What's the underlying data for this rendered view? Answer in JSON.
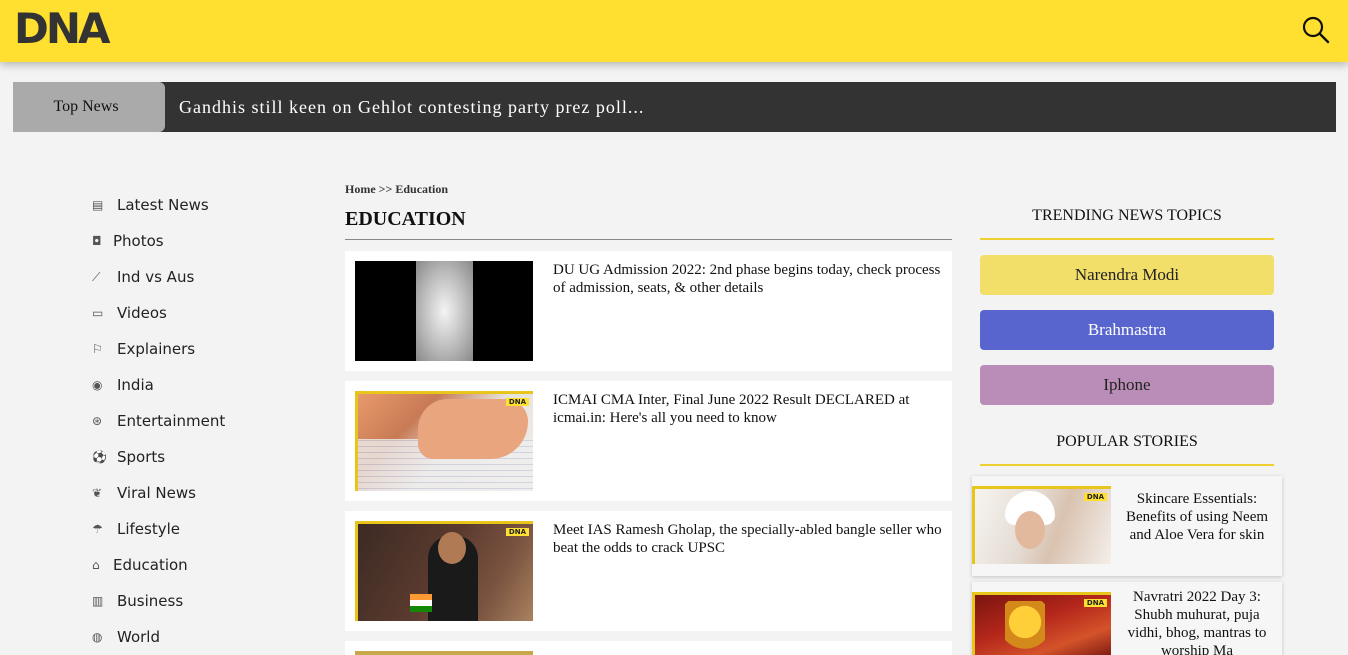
{
  "header": {
    "logo": "DNA",
    "search_icon": "search-icon",
    "colors": {
      "brand_yellow": "#ffdf30",
      "ticker_bg": "#333333"
    }
  },
  "ticker": {
    "label": "Top News",
    "headline": "Gandhis still keen on Gehlot contesting party prez poll..."
  },
  "nav": {
    "items": [
      {
        "label": "Latest News",
        "icon": "newspaper-icon"
      },
      {
        "label": "Photos",
        "icon": "camera-icon"
      },
      {
        "label": "Ind vs Aus",
        "icon": "cricket-bat-icon"
      },
      {
        "label": "Videos",
        "icon": "video-icon"
      },
      {
        "label": "Explainers",
        "icon": "explainer-icon"
      },
      {
        "label": "India",
        "icon": "india-emblem-icon"
      },
      {
        "label": "Entertainment",
        "icon": "film-reel-icon"
      },
      {
        "label": "Sports",
        "icon": "football-icon"
      },
      {
        "label": "Viral News",
        "icon": "viral-icon"
      },
      {
        "label": "Lifestyle",
        "icon": "umbrella-icon"
      },
      {
        "label": "Education",
        "icon": "graduation-cap-icon"
      },
      {
        "label": "Business",
        "icon": "briefcase-icon"
      },
      {
        "label": "World",
        "icon": "globe-icon"
      }
    ]
  },
  "main": {
    "breadcrumb": {
      "home": "Home",
      "sep": ">>",
      "current": "Education"
    },
    "title": "EDUCATION",
    "articles": [
      {
        "title": "DU UG Admission 2022: 2nd phase begins today, check process of admission, seats, & other details"
      },
      {
        "title": "ICMAI CMA Inter, Final June 2022 Result DECLARED at icmai.in: Here's all you need to know"
      },
      {
        "title": "Meet IAS Ramesh Gholap, the specially-abled bangle seller who beat the odds to crack UPSC"
      }
    ],
    "thumb_badge": "DNA"
  },
  "sidebar": {
    "trending_heading": "TRENDING NEWS TOPICS",
    "topics": [
      {
        "label": "Narendra Modi",
        "bg": "#f2df6a",
        "fg": "#222222"
      },
      {
        "label": "Brahmastra",
        "bg": "#5865cf",
        "fg": "#ffffff"
      },
      {
        "label": "Iphone",
        "bg": "#b98db7",
        "fg": "#222222"
      }
    ],
    "popular_heading": "POPULAR STORIES",
    "stories": [
      {
        "title": "Skincare Essentials: Benefits of using Neem and Aloe Vera for skin"
      },
      {
        "title": "Navratri 2022 Day 3: Shubh muhurat, puja vidhi, bhog, mantras to worship Ma"
      }
    ]
  }
}
